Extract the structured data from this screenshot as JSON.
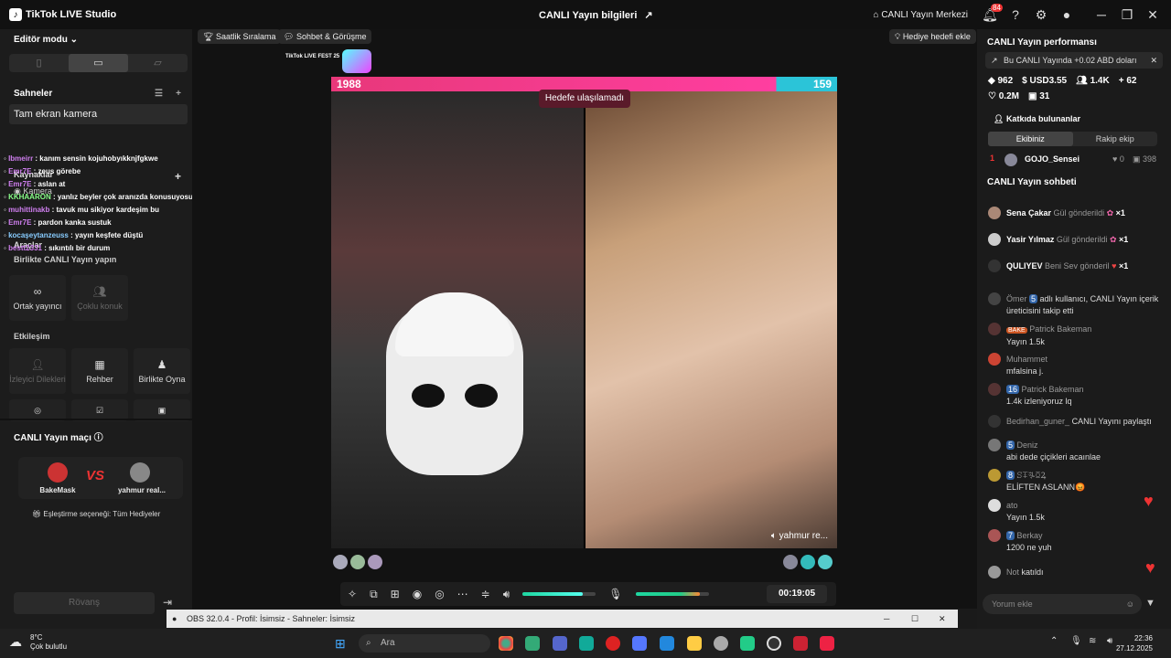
{
  "app": {
    "title": "TikTok LIVE Studio",
    "center_title": "CANLI Yayın bilgileri",
    "live_center": "CANLI Yayın Merkezi",
    "notif_count": "84"
  },
  "left": {
    "editor_mode": "Editör modu",
    "scenes_title": "Sahneler",
    "scene_item": "Tam ekran kamera",
    "sources_title": "Kaynaklar",
    "camera": "Kamera",
    "tools_title": "Araçlar",
    "together": "Birlikte CANLI Yayın yapın",
    "cohost": "Ortak yayıncı",
    "multi_guest": "Çoklu konuk",
    "interaction": "Etkileşim",
    "viewer_requests": "İzleyici Dilekleri",
    "guide": "Rehber",
    "play_together": "Birlikte Oyna",
    "match_title": "CANLI Yayın maçı",
    "player1": "BakeMask",
    "player2": "yahmur real...",
    "vs": "VS",
    "match_option": "Eşleştirme seçeneği: Tüm Hediyeler",
    "rematch": "Rövanş"
  },
  "chat_overlay": [
    {
      "user": "Ibmeirr",
      "text": "kanım sensin kojuhobyıkknjfgkwe"
    },
    {
      "user": "Emr7E",
      "text": "zeus görebe"
    },
    {
      "user": "Emr7E",
      "text": "aslan at"
    },
    {
      "user": "KKHAARON",
      "text": "yanlız beyler çok aranızda konusuyosunuz yeni gelenler sohbete dahil olamiyor"
    },
    {
      "user": "muhittinakb",
      "text": "tavuk mu sikiyor kardeşim bu"
    },
    {
      "user": "Emr7E",
      "text": "pardon kanka sustuk"
    },
    {
      "user": "kocaşeytanzeuss",
      "text": "yayın keşfete düştü"
    },
    {
      "user": "bestt2331",
      "text": "sıkıntılı bir durum"
    }
  ],
  "center": {
    "chip1": "Saatlik Sıralama",
    "chip2": "Sohbet & Görüşme",
    "gift_goal": "Hediye hedefi ekle",
    "fest": "TikTok LIVE FEST 25",
    "score_left": "1988",
    "score_right": "159",
    "goal_msg": "Hedefe ulaşılamadı",
    "guest_name": "yahmur re...",
    "timer": "00:19:05"
  },
  "right": {
    "perf_title": "CANLI Yayın performansı",
    "notice": "Bu CANLI Yayında +0.02 ABD doları",
    "stat1": "962",
    "stat2": "USD3.55",
    "stat3": "1.4K",
    "stat4": "62",
    "stat5": "0.2M",
    "stat6": "31",
    "contributors": "Katkıda bulunanlar",
    "tab1": "Ekibiniz",
    "tab2": "Rakip ekip",
    "rank": "1",
    "rank_user": "GOJO_Sensei",
    "rank_likes": "0",
    "rank_gifts": "398",
    "chat_title": "CANLI Yayın sohbeti",
    "comment_ph": "Yorum ekle"
  },
  "gifts": [
    {
      "user": "Sena Çakar",
      "text": "Gül gönderildi",
      "count": "×1"
    },
    {
      "user": "Yasir Yılmaz",
      "text": "Gül gönderildi",
      "count": "×1"
    },
    {
      "user": "QULIYEV",
      "text": "Beni Sev gönderil",
      "count": "×1"
    }
  ],
  "messages": [
    {
      "user": "Ömer",
      "badge": "5",
      "text": "adlı kullanıcı, CANLI Yayın içerik üreticisini takip etti"
    },
    {
      "user": "Patrick Bakeman",
      "badge": "BAKE",
      "text": "Yayın 1.5k"
    },
    {
      "user": "Muhammet",
      "badge": "",
      "text": "mfalsina j."
    },
    {
      "user": "Patrick Bakeman",
      "badge": "16",
      "text": "1.4k izleniyoruz lq"
    },
    {
      "user": "Bedirhan_guner_",
      "badge": "",
      "text": "CANLI Yayını paylaştı"
    },
    {
      "user": "Deniz",
      "badge": "5",
      "text": "abi dede çiçikleri acaınlae"
    },
    {
      "user": "ꕶꔊꔨꗞꝜ",
      "badge": "8",
      "text": "ELİFTEN ASLANN😡"
    },
    {
      "user": "ato",
      "badge": "",
      "text": "Yayın 1.5k"
    },
    {
      "user": "Berkay",
      "badge": "7",
      "text": "1200 ne yuh"
    },
    {
      "user": "Not",
      "badge": "",
      "text": "katıldı"
    }
  ],
  "obs": {
    "title": "OBS 32.0.4 - Profil: İsimsiz - Sahneler: İsimsiz"
  },
  "taskbar": {
    "temp": "8°C",
    "weather": "Çok bulutlu",
    "search": "Ara",
    "time": "22:36",
    "date": "27.12.2025"
  }
}
